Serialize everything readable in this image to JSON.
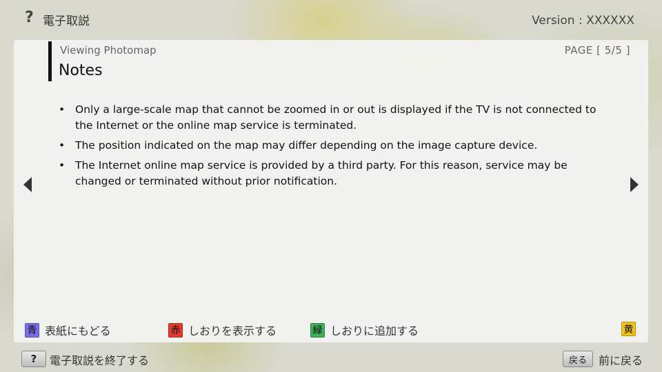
{
  "header": {
    "help_icon": "?",
    "app_title": "電子取説",
    "version": "Version : XXXXXX"
  },
  "panel": {
    "section": "Viewing Photomap",
    "page_indicator": "PAGE [ 5/5 ]",
    "title": "Notes",
    "notes": [
      "Only a large-scale map that cannot be zoomed in or out is displayed if the TV is not connected to the Internet or the online map service is terminated.",
      "The position indicated on the map may differ depending on the image capture device.",
      "The Internet online map service is provided by a third party. For this reason, service may be changed or terminated without prior notification."
    ],
    "nav_icons": [
      "left-arrow-icon",
      "right-arrow-icon"
    ]
  },
  "color_keys": [
    {
      "key": "青",
      "label": "表紙にもどる",
      "color": "#7a6ee8"
    },
    {
      "key": "赤",
      "label": "しおりを表示する",
      "color": "#e23a2e"
    },
    {
      "key": "緑",
      "label": "しおりに追加する",
      "color": "#3fb05a"
    },
    {
      "key": "黄",
      "label": "",
      "color": "#f0c419"
    }
  ],
  "footer": {
    "help_button": "?",
    "exit_label": "電子取説を終了する",
    "back_button": "戻る",
    "back_label": "前に戻る"
  }
}
